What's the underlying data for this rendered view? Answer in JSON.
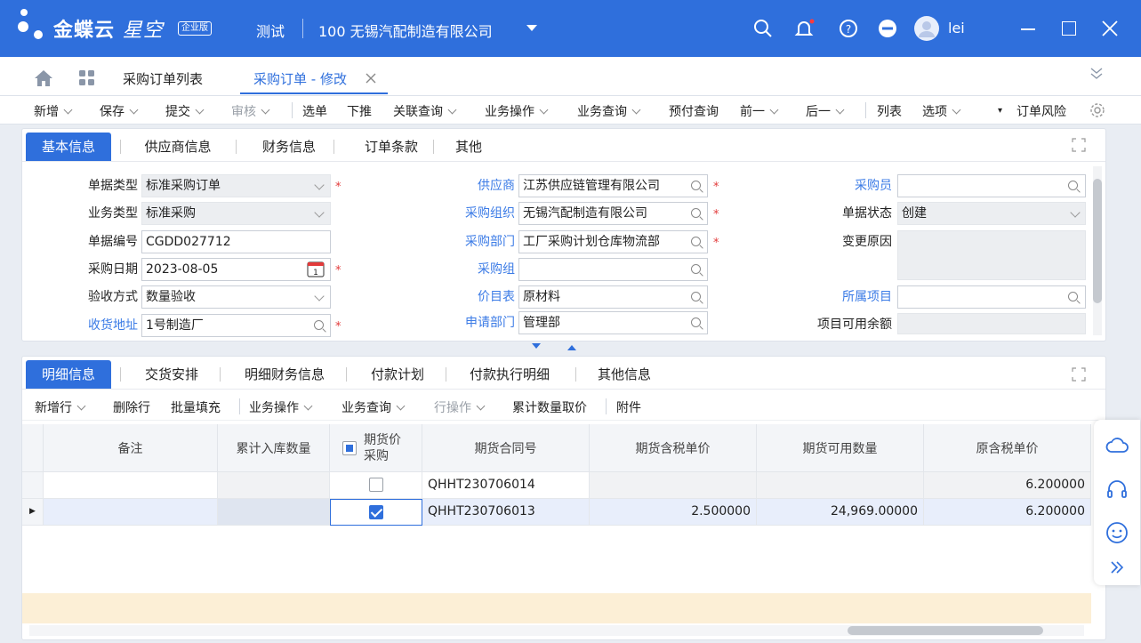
{
  "app": {
    "brand": "金蝶云",
    "product": "星空",
    "edition": "企业版",
    "env": "测试",
    "org": "100  无锡汽配制造有限公司",
    "user": "lei"
  },
  "tabs": {
    "list": "采购订单列表",
    "active": "采购订单 - 修改"
  },
  "toolbar": [
    "新增",
    "保存",
    "提交",
    "审核",
    "选单",
    "下推",
    "关联查询",
    "业务操作",
    "业务查询",
    "预付查询",
    "前一",
    "后一",
    "列表",
    "选项",
    "订单风险"
  ],
  "header_tabs": [
    "基本信息",
    "供应商信息",
    "财务信息",
    "订单条款",
    "其他"
  ],
  "form": {
    "doc_type": {
      "label": "单据类型",
      "value": "标准采购订单"
    },
    "biz_type": {
      "label": "业务类型",
      "value": "标准采购"
    },
    "doc_no": {
      "label": "单据编号",
      "value": "CGDD027712"
    },
    "po_date": {
      "label": "采购日期",
      "value": "2023-08-05"
    },
    "accept": {
      "label": "验收方式",
      "value": "数量验收"
    },
    "ship_addr": {
      "label": "收货地址",
      "value": "1号制造厂"
    },
    "supplier": {
      "label": "供应商",
      "value": "江苏供应链管理有限公司"
    },
    "purch_org": {
      "label": "采购组织",
      "value": "无锡汽配制造有限公司"
    },
    "purch_dept": {
      "label": "采购部门",
      "value": "工厂采购计划仓库物流部"
    },
    "purch_group": {
      "label": "采购组",
      "value": ""
    },
    "price_list": {
      "label": "价目表",
      "value": "原材料"
    },
    "req_dept": {
      "label": "申请部门",
      "value": "管理部"
    },
    "buyer": {
      "label": "采购员",
      "value": ""
    },
    "status": {
      "label": "单据状态",
      "value": "创建"
    },
    "change_reason": {
      "label": "变更原因",
      "value": ""
    },
    "project": {
      "label": "所属项目",
      "value": ""
    },
    "project_bal": {
      "label": "项目可用余额",
      "value": ""
    }
  },
  "detail_tabs": [
    "明细信息",
    "交货安排",
    "明细财务信息",
    "付款计划",
    "付款执行明细",
    "其他信息"
  ],
  "detail_toolbar": [
    "新增行",
    "删除行",
    "批量填充",
    "业务操作",
    "业务查询",
    "行操作",
    "累计数量取价",
    "附件"
  ],
  "columns": [
    "备注",
    "累计入库数量",
    "期货价采购",
    "期货合同号",
    "期货含税单价",
    "期货可用数量",
    "原含税单价"
  ],
  "rows": [
    {
      "remark": "",
      "in_qty": "",
      "futures": false,
      "contract": "QHHT230706014",
      "fut_price": "",
      "fut_qty": "",
      "orig_price": "6.200000"
    },
    {
      "remark": "",
      "in_qty": "",
      "futures": true,
      "contract": "QHHT230706013",
      "fut_price": "2.500000",
      "fut_qty": "24,969.00000",
      "orig_price": "6.200000"
    }
  ]
}
